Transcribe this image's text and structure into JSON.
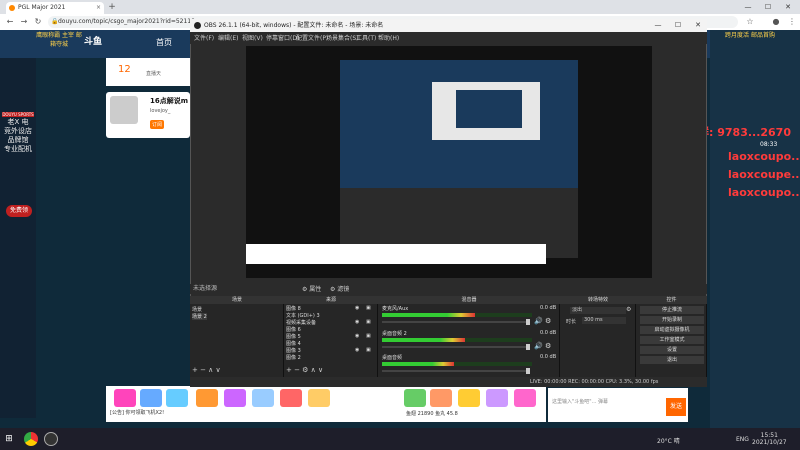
{
  "browser": {
    "tab_title": "PGL Major 2021",
    "new_tab": "+",
    "url": "douyu.com/topic/csgo_major2021?rid=52118",
    "win_min": "—",
    "win_max": "☐",
    "win_close": "✕"
  },
  "douyu": {
    "logo": "斗鱼",
    "nav_home": "首页",
    "header_ad_left": "鹰眼称霸 主宰 邮箱夺城",
    "header_ad_right": "跨月度活 邮品首购",
    "follow_count": "12",
    "follow_label": "直播天",
    "anchor_name": "16点解说m",
    "anchor_tag": "lovejoy_",
    "anchor_btn": "订阅",
    "left_tag": "DOUYU SPORTS",
    "left_vertical_text": "老X 电竞外设店 品牌馆 专业配机",
    "left_button": "免费领",
    "right_countdown": "08:33",
    "float_1": "水友群: 9783...2670",
    "float_2": "laoxcoupo...",
    "float_3": "laoxcoupe...",
    "float_4": "laoxcoupo...",
    "gift_tip": "[公告] 你可领取飞机X2!",
    "fish_balance": "鱼翅 21890  鱼丸 45.8",
    "chat_placeholder": "这里输入\"斗鱼吧\"... 弹幕",
    "chat_send": "发送"
  },
  "obs": {
    "title": "OBS 26.1.1 (64-bit, windows) - 配置文件: 未命名 - 场景: 未命名",
    "menus": [
      "文件(F)",
      "编辑(E)",
      "视图(V)",
      "停靠窗口(D)",
      "配置文件(P)",
      "场景集合(S)",
      "工具(T)",
      "帮助(H)"
    ],
    "no_source": "未选择源",
    "btn_props": "⚙ 属性",
    "btn_filters": "⚙ 滤镜",
    "docks": {
      "scenes": "场景",
      "sources": "来源",
      "mixer": "混音器",
      "transitions": "转场特效",
      "controls": "控件"
    },
    "scenes": [
      "场景",
      "场景 2"
    ],
    "sources": [
      "图像 8",
      "文本 (GDI+) 3",
      "视频采集设备",
      "图像 6",
      "图像 5",
      "图像 4",
      "图像 3",
      "图像 2"
    ],
    "mixer": [
      {
        "name": "麦克风/Aux",
        "db": "0.0 dB",
        "level": 0.62
      },
      {
        "name": "桌面音频 2",
        "db": "0.0 dB",
        "level": 0.55
      },
      {
        "name": "桌面音频",
        "db": "0.0 dB",
        "level": 0.48
      }
    ],
    "transition": "淡出",
    "duration_label": "时长",
    "duration_value": "300 ms",
    "controls": [
      "停止推流",
      "开始录制",
      "启动虚拟摄像机",
      "工作室模式",
      "设置",
      "退出"
    ],
    "status": "LIVE: 00:00:00   REC: 00:00:00   CPU: 3.3%, 30.00 fps"
  },
  "taskbar": {
    "start": "⊞",
    "weather": "20°C 晴",
    "lang": "ENG",
    "time": "15:51",
    "date": "2021/10/27"
  }
}
